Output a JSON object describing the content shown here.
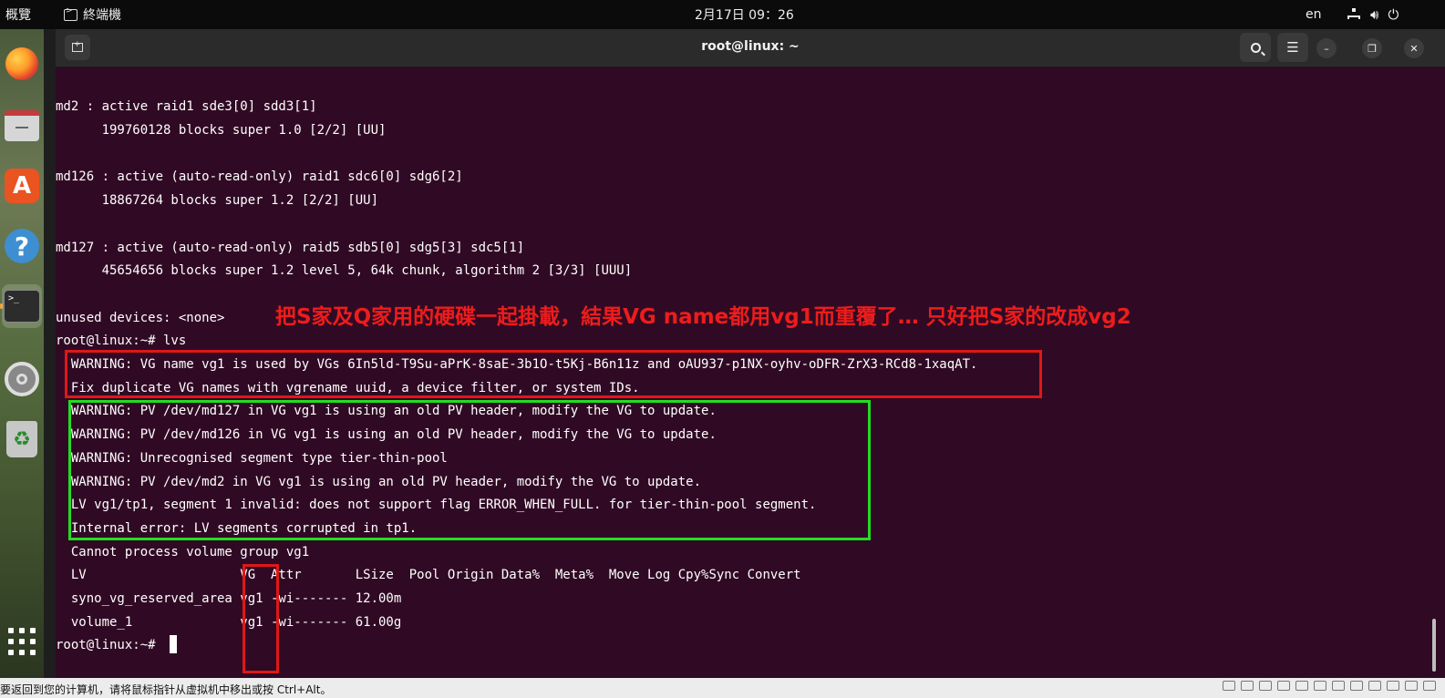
{
  "topbar": {
    "activities": "概覽",
    "app_name": "終端機",
    "clock": "2月17日  09：26",
    "lang": "en",
    "icons": [
      "network-icon",
      "volume-icon",
      "power-icon"
    ]
  },
  "dock": {
    "items": [
      "firefox",
      "files",
      "app-center",
      "help",
      "terminal",
      "settings",
      "trash",
      "show-apps"
    ],
    "trash_glyph": "♻",
    "help_glyph": "?",
    "terminal_glyph": ">_"
  },
  "window": {
    "title": "root@linux: ~",
    "menu_glyph": "☰",
    "minimize_glyph": "–",
    "maximize_glyph": "❐",
    "close_glyph": "✕"
  },
  "terminal": {
    "lines": [
      "md2 : active raid1 sde3[0] sdd3[1]",
      "      199760128 blocks super 1.0 [2/2] [UU]",
      "",
      "md126 : active (auto-read-only) raid1 sdc6[0] sdg6[2]",
      "      18867264 blocks super 1.2 [2/2] [UU]",
      "",
      "md127 : active (auto-read-only) raid5 sdb5[0] sdg5[3] sdc5[1]",
      "      45654656 blocks super 1.2 level 5, 64k chunk, algorithm 2 [3/3] [UUU]",
      "",
      "unused devices: <none>",
      "root@linux:~# lvs",
      "  WARNING: VG name vg1 is used by VGs 6In5ld-T9Su-aPrK-8saE-3b1O-t5Kj-B6n11z and oAU937-p1NX-oyhv-oDFR-ZrX3-RCd8-1xaqAT.",
      "  Fix duplicate VG names with vgrename uuid, a device filter, or system IDs.",
      "  WARNING: PV /dev/md127 in VG vg1 is using an old PV header, modify the VG to update.",
      "  WARNING: PV /dev/md126 in VG vg1 is using an old PV header, modify the VG to update.",
      "  WARNING: Unrecognised segment type tier-thin-pool",
      "  WARNING: PV /dev/md2 in VG vg1 is using an old PV header, modify the VG to update.",
      "  LV vg1/tp1, segment 1 invalid: does not support flag ERROR_WHEN_FULL. for tier-thin-pool segment.",
      "  Internal error: LV segments corrupted in tp1.",
      "  Cannot process volume group vg1",
      "  LV                    VG  Attr       LSize  Pool Origin Data%  Meta%  Move Log Cpy%Sync Convert",
      "  syno_vg_reserved_area vg1 -wi------- 12.00m",
      "  volume_1              vg1 -wi------- 61.00g",
      "root@linux:~# "
    ]
  },
  "annotation": {
    "text": "把S家及Q家用的硬碟一起掛載，結果VG name都用vg1而重覆了… 只好把S家的改成vg2",
    "color": "#ee1c1c"
  },
  "statusbar": {
    "message": "要返回到您的计算机，请将鼠标指针从虚拟机中移出或按 Ctrl+Alt。"
  },
  "colors": {
    "terminal_bg": "#300a24",
    "red_box": "#e01717",
    "green_box": "#22dd22"
  }
}
